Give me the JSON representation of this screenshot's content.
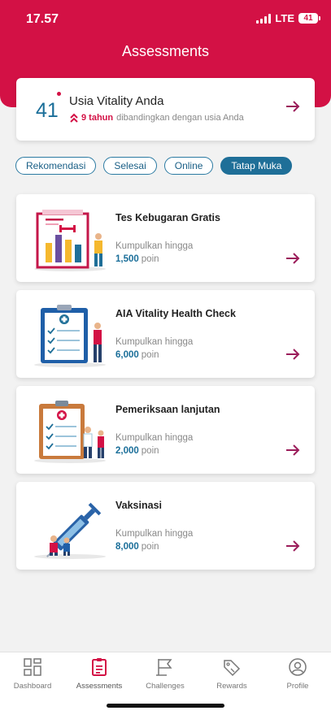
{
  "status_bar": {
    "time": "17.57",
    "network": "LTE",
    "battery": "41"
  },
  "header": {
    "title": "Assessments"
  },
  "vitality": {
    "age": "41",
    "title": "Usia Vitality Anda",
    "years": "9 tahun",
    "comparison": "dibandingkan dengan usia Anda"
  },
  "filters": [
    "Rekomendasi",
    "Selesai",
    "Online",
    "Tatap Muka"
  ],
  "active_filter": "Tatap Muka",
  "cards": [
    {
      "title": "Tes Kebugaran Gratis",
      "label": "Kumpulkan hingga",
      "points": "1,500",
      "unit": "poin",
      "illustration": "fitness-chart-illustration"
    },
    {
      "title": "AIA Vitality Health Check",
      "label": "Kumpulkan hingga",
      "points": "6,000",
      "unit": "poin",
      "illustration": "health-checklist-illustration"
    },
    {
      "title": "Pemeriksaan lanjutan",
      "label": "Kumpulkan hingga",
      "points": "2,000",
      "unit": "poin",
      "illustration": "medical-clipboard-illustration"
    },
    {
      "title": "Vaksinasi",
      "label": "Kumpulkan hingga",
      "points": "8,000",
      "unit": "poin",
      "illustration": "vaccine-syringe-illustration"
    }
  ],
  "bottom_nav": [
    {
      "label": "Dashboard",
      "icon": "dashboard-icon"
    },
    {
      "label": "Assessments",
      "icon": "clipboard-icon",
      "active": true
    },
    {
      "label": "Challenges",
      "icon": "flag-icon"
    },
    {
      "label": "Rewards",
      "icon": "tag-icon"
    },
    {
      "label": "Profile",
      "icon": "profile-icon"
    }
  ],
  "colors": {
    "brand": "#d31145",
    "accent": "#1a6e99",
    "arrow": "#9b1c5a"
  }
}
